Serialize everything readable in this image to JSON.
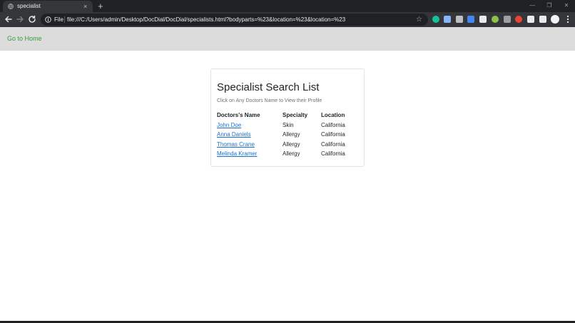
{
  "browser": {
    "tab_title": "specialist",
    "tab_close": "×",
    "new_tab": "+",
    "window_controls": {
      "minimize": "—",
      "maximize": "❐",
      "close": "✕"
    },
    "file_label": "File",
    "url": "file:///C:/Users/admin/Desktop/DocDial/DocDial/specialists.html?bodyparts=%23&location=%23&location=%23",
    "star": "☆",
    "extensions": [
      {
        "name": "grammarly-icon",
        "color": "#15c39a"
      },
      {
        "name": "download-ext-icon",
        "color": "#8ab4f8"
      },
      {
        "name": "mute-tab-icon",
        "color": "#bdc1c6"
      },
      {
        "name": "iq-ext-icon",
        "color": "#4285f4"
      },
      {
        "name": "tab-ext-icon",
        "color": "#e8eaed"
      },
      {
        "name": "green-ext-icon",
        "color": "#8bc34a"
      },
      {
        "name": "chart-ext-icon",
        "color": "#9aa0a6"
      },
      {
        "name": "red-ext-icon",
        "color": "#ea4335"
      },
      {
        "name": "puzzle-icon",
        "color": "#e8eaed"
      },
      {
        "name": "playlist-icon",
        "color": "#e8eaed"
      }
    ]
  },
  "nav": {
    "home_link": "Go to Home"
  },
  "card": {
    "title": "Specialist Search List",
    "subtitle": "Click on Any Doctors Name to View their Profile",
    "headers": {
      "name": "Doctors's Name",
      "specialty": "Specialty",
      "location": "Location"
    },
    "rows": [
      {
        "name": "John Doe",
        "specialty": "Skin",
        "location": "California"
      },
      {
        "name": "Anna Daniels",
        "specialty": "Allergy",
        "location": "California"
      },
      {
        "name": "Thomas Crane",
        "specialty": "Allergy",
        "location": "California"
      },
      {
        "name": "Melinda Kramer",
        "specialty": "Allergy",
        "location": "California"
      }
    ]
  }
}
